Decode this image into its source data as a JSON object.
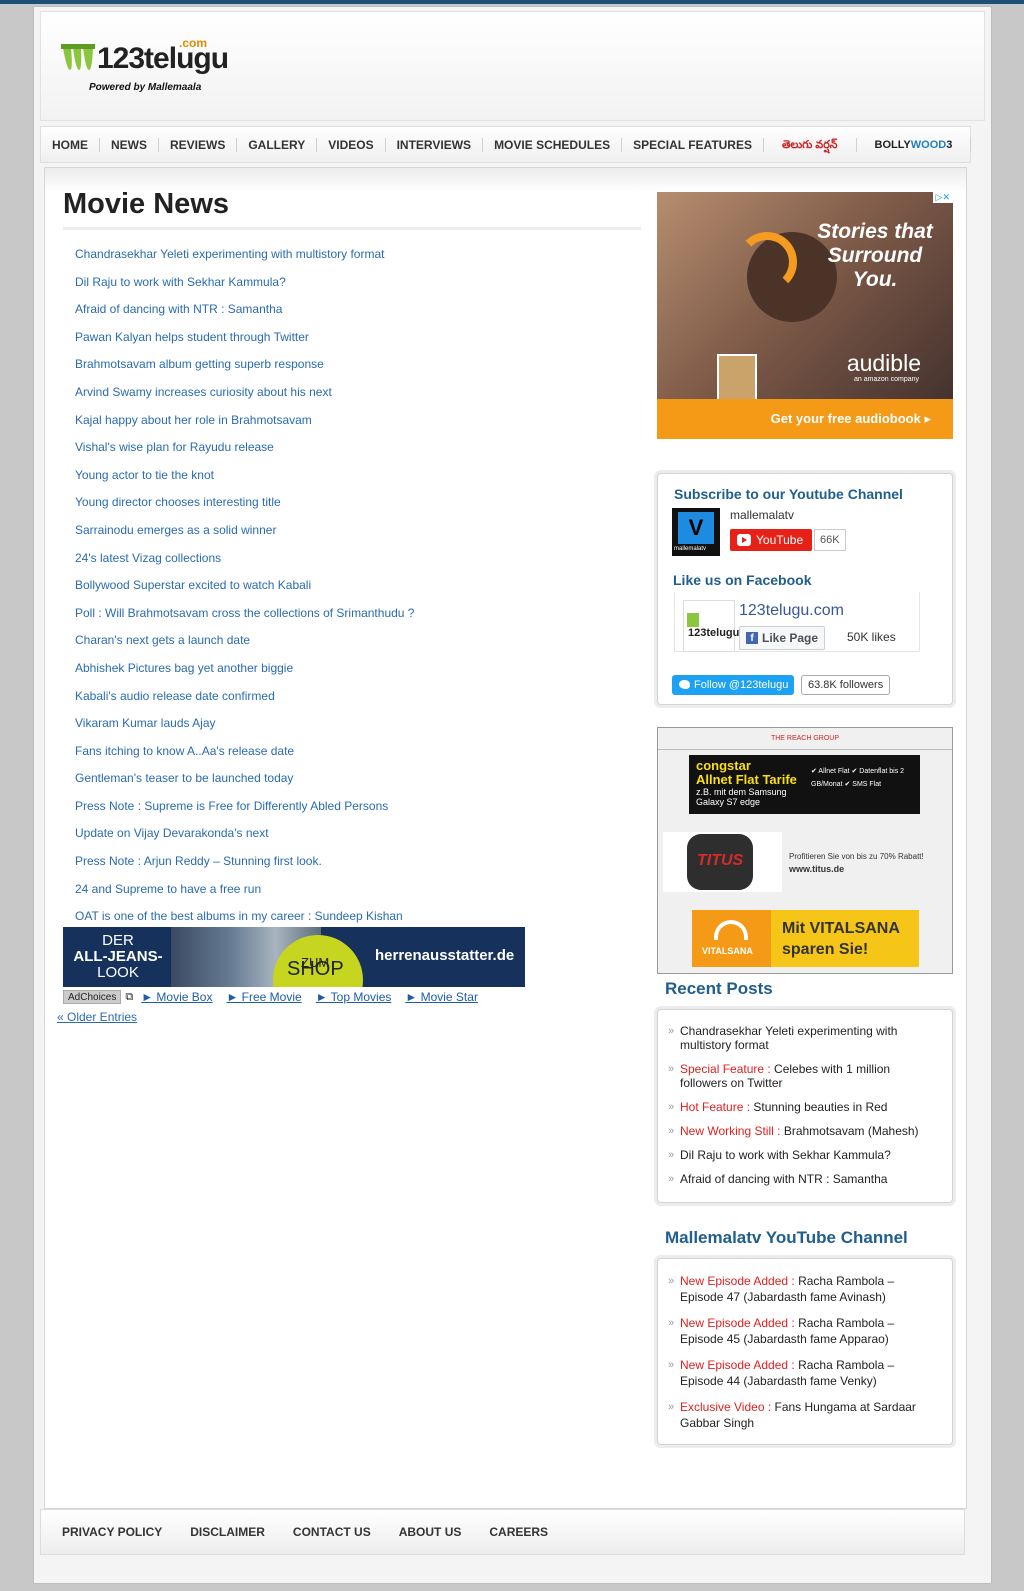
{
  "header": {
    "brand": "123telugu",
    "brand_suffix": ".com",
    "tagline": "Powered by Mallemaala"
  },
  "nav": {
    "items": [
      "HOME",
      "NEWS",
      "REVIEWS",
      "GALLERY",
      "VIDEOS",
      "INTERVIEWS",
      "MOVIE SCHEDULES",
      "SPECIAL FEATURES"
    ],
    "telugu_label": "తెలుగు వర్షన్",
    "bolly_label_a": "BOLLY",
    "bolly_label_b": "WOOD",
    "bolly_label_c": "3"
  },
  "main": {
    "title": "Movie News",
    "news": [
      "Chandrasekhar Yeleti experimenting with multistory format",
      "Dil Raju to work with Sekhar Kammula?",
      "Afraid of dancing with NTR : Samantha",
      "Pawan Kalyan helps student through Twitter",
      "Brahmotsavam album getting superb response",
      "Arvind Swamy increases curiosity about his next",
      "Kajal happy about her role in Brahmotsavam",
      "Vishal's wise plan for Rayudu release",
      "Young actor to tie the knot",
      "Young director chooses interesting title",
      "Sarrainodu emerges as a solid winner",
      "24's latest Vizag collections",
      "Bollywood Superstar excited to watch Kabali",
      "Poll : Will Brahmotsavam cross the collections of Srimanthudu ?",
      "Charan's next gets a launch date",
      "Abhishek Pictures bag yet another biggie",
      "Kabali's audio release date confirmed",
      "Vikaram Kumar lauds Ajay",
      "Fans itching to know A..Aa's release date",
      "Gentleman's teaser to be launched today",
      "Press Note : Supreme is Free for Differently Abled Persons",
      "Update on Vijay Devarakonda's next",
      "Press Note : Arjun Reddy – Stunning first look.",
      "24 and Supreme to have a free run",
      "OAT is one of the best albums in my career : Sundeep Kishan"
    ],
    "banner": {
      "line1": "DER",
      "line2": "ALL-JEANS-",
      "line3": "LOOK",
      "shop1": "ZUM",
      "shop2": "SHOP",
      "site": "herrenausstatter.de"
    },
    "adchoices_label": "AdChoices",
    "ad_links": [
      "► Movie Box",
      "► Free Movie",
      "► Top Movies",
      "► Movie Star"
    ],
    "older_entries": "« Older Entries"
  },
  "sidebar": {
    "audible": {
      "headline": "Stories that Surround You.",
      "brand": "audible",
      "sub": "an amazon company",
      "cta": "Get your free audiobook ▸"
    },
    "youtube": {
      "title": "Subscribe to our Youtube Channel",
      "channel": "mallemalatv",
      "button": "YouTube",
      "count": "66K"
    },
    "facebook": {
      "title": "Like us on Facebook",
      "page": "123telugu.com",
      "like_button": "Like Page",
      "likes": "50K likes"
    },
    "twitter": {
      "button": "Follow @123telugu",
      "followers": "63.8K followers"
    },
    "reach_ad": {
      "label": "THE REACH GROUP",
      "congstar_a": "congstar",
      "congstar_b": "Allnet Flat Tarife",
      "congstar_c": "z.B. mit dem Samsung Galaxy S7 edge",
      "congstar_d": "✔ Allnet Flat ✔ Datenflat bis 2 GB/Monat ✔ SMS Flat",
      "titus_text": "Profitieren Sie von bis zu 70% Rabatt!",
      "titus_url": "www.titus.de",
      "vitalsana_label": "VITALSANA",
      "vitalsana_text": "Mit VITALSANA sparen Sie!"
    },
    "recent_title": "Recent Posts",
    "recent": [
      {
        "tag": "",
        "text": "Chandrasekhar Yeleti experimenting with multistory format"
      },
      {
        "tag": "Special Feature :",
        "text": " Celebes with 1 million followers on Twitter"
      },
      {
        "tag": "Hot Feature :",
        "text": " Stunning beauties in Red"
      },
      {
        "tag": "New Working Still :",
        "text": " Brahmotsavam (Mahesh)"
      },
      {
        "tag": "",
        "text": "Dil Raju to work with Sekhar Kammula?"
      },
      {
        "tag": "",
        "text": "Afraid of dancing with NTR : Samantha"
      }
    ],
    "yt_title": "Mallemalatv YouTube Channel",
    "yt_items": [
      {
        "tag": "New Episode Added :",
        "text": " Racha Rambola – Episode 47 (Jabardasth fame Avinash)"
      },
      {
        "tag": "New Episode Added :",
        "text": " Racha Rambola – Episode 45 (Jabardasth fame Apparao)"
      },
      {
        "tag": "New Episode Added :",
        "text": " Racha Rambola – Episode 44 (Jabardasth fame Venky)"
      },
      {
        "tag": "Exclusive Video :",
        "text": " Fans Hungama at Sardaar Gabbar Singh"
      }
    ]
  },
  "footer": {
    "links": [
      "PRIVACY POLICY",
      "DISCLAIMER",
      "CONTACT US",
      "ABOUT US",
      "CAREERS"
    ]
  }
}
